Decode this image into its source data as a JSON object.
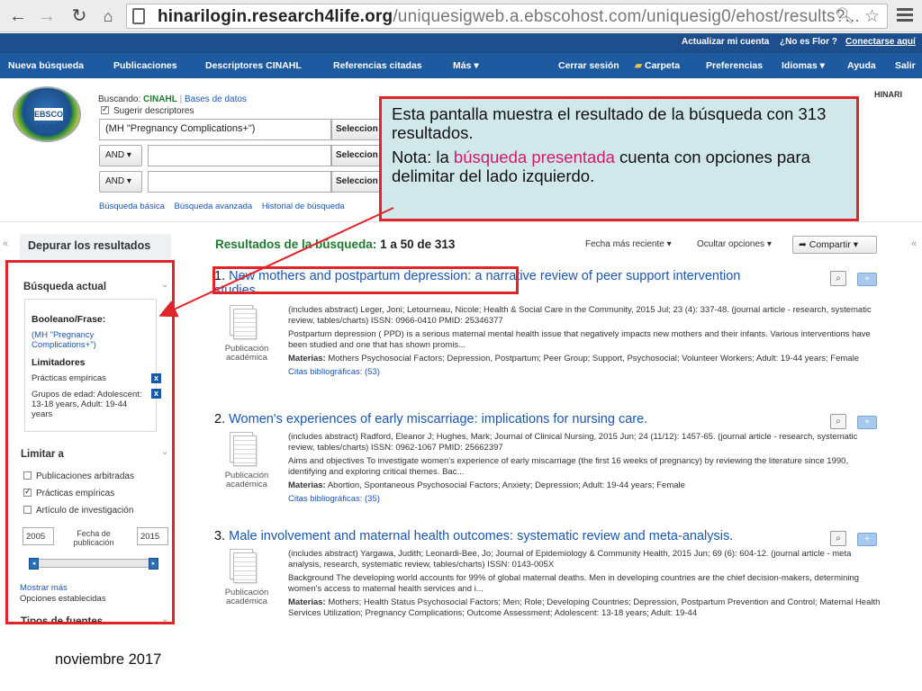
{
  "browser": {
    "url_host": "hinarilogin.research4life.org",
    "url_path": "/uniquesigweb.a.ebscohost.com/uniquesig0/ehost/results?..."
  },
  "topbar": {
    "update": "Actualizar mi cuenta",
    "not_user": "¿No es Flor ?",
    "logout": "Conectarse aquí"
  },
  "mainnav": {
    "left": [
      "Nueva búsqueda",
      "Publicaciones",
      "Descriptores CINAHL",
      "Referencias citadas",
      "Más"
    ],
    "right": [
      "Cerrar sesión",
      "Carpeta",
      "Preferencias",
      "Idiomas",
      "Ayuda",
      "Salir"
    ]
  },
  "search": {
    "logo_text": "EBSCO HOST",
    "searching_label": "Buscando:",
    "database": "CINAHL",
    "databases_link": "Bases de datos",
    "suggest": "Sugerir descriptores",
    "query": "(MH \"Pregnancy Complications+\")",
    "select_label": "Seleccion",
    "bool1": "AND",
    "bool2": "AND",
    "links": [
      "Búsqueda básica",
      "Búsqueda avanzada",
      "Historial de búsqueda"
    ],
    "hinari": "HINARI"
  },
  "callout": {
    "p1": "Esta pantalla muestra el resultado de la búsqueda con 313 resultados.",
    "p2_a": "Nota:  la ",
    "p2_pink": "búsqueda presentada",
    "p2_b": " cuenta con opciones para delimitar del lado izquierdo."
  },
  "sidebar": {
    "title": "Depurar los resultados",
    "current_search": "Búsqueda actual",
    "boolean_label": "Booleano/Frase:",
    "boolean_value": "(MH \"Pregnancy Complications+\")",
    "limiters_label": "Limitadores",
    "limiter1": "Prácticas empíricas",
    "limiter2": "Grupos de edad: Adolescent: 13-18 years, Adult: 19-44 years",
    "limit_to": "Limitar a",
    "limit_items": [
      "Publicaciones arbitradas",
      "Prácticas empíricas",
      "Artículo de investigación"
    ],
    "year_from": "2005",
    "year_to": "2015",
    "date_label": "Fecha de publicación",
    "show_more": "Mostrar más",
    "options_set": "Opciones establecidas",
    "source_types": "Tipos de fuentes"
  },
  "results": {
    "heading": "Resultados de la búsqueda:",
    "count": "1 a 50 de 313",
    "sort": "Fecha más reciente",
    "hide_options": "Ocultar opciones",
    "share": "Compartir",
    "items": [
      {
        "num": "1.",
        "title": "New mothers and postpartum depression: a narrative review of peer support intervention studies.",
        "citation": "(includes abstract) Leger, Joni; Letourneau, Nicole; Health & Social Care in the Community, 2015 Jul; 23 (4): 337-48. (journal article - research, systematic review, tables/charts) ISSN: 0966-0410 PMID: 25346377",
        "abstract": "Postpartum depression ( PPD) is a serious maternal mental health issue that negatively impacts new mothers and their infants. Various interventions have been studied and one that has shown promis...",
        "subjects_label": "Materias:",
        "subjects": " Mothers Psychosocial Factors; Depression, Postpartum; Peer Group; Support, Psychosocial; Volunteer Workers; Adult: 19-44 years; Female",
        "cited": "Citas bibliográficas: (53)",
        "type": "Publicación académica"
      },
      {
        "num": "2.",
        "title": "Women's experiences of early miscarriage: implications for nursing care.",
        "citation": "(includes abstract) Radford, Eleanor J; Hughes, Mark; Journal of Clinical Nursing, 2015 Jun; 24 (11/12): 1457-65. (journal article - research, systematic review, tables/charts) ISSN: 0962-1067 PMID: 25662397",
        "abstract": "Aims and objectives To investigate women's experience of early miscarriage (the first 16 weeks of pregnancy) by reviewing the literature since 1990, identifying and exploring critical themes. Bac...",
        "subjects_label": "Materias:",
        "subjects": " Abortion, Spontaneous Psychosocial Factors; Anxiety; Depression; Adult: 19-44 years; Female",
        "cited": "Citas bibliográficas: (35)",
        "type": "Publicación académica"
      },
      {
        "num": "3.",
        "title": "Male involvement and maternal health outcomes: systematic review and meta-analysis.",
        "citation": "(includes abstract) Yargawa, Judith; Leonardi-Bee, Jo; Journal of Epidemiology & Community Health, 2015 Jun; 69 (6): 604-12. (journal article - meta analysis, research, systematic review, tables/charts) ISSN: 0143-005X",
        "abstract": "Background The developing world accounts for 99% of global maternal deaths. Men in developing countries are the chief decision-makers, determining women's access to maternal health services and i...",
        "subjects_label": "Materias:",
        "subjects": " Mothers; Health Status Psychosocial Factors; Men; Role; Developing Countries; Depression, Postpartum Prevention and Control; Maternal Health Services Utilization; Pregnancy Complications; Outcome Assessment; Adolescent: 13-18 years; Adult: 19-44",
        "cited": "",
        "type": "Publicación académica"
      }
    ]
  },
  "footer": "noviembre 2017",
  "colors": {
    "accent_blue": "#1d5aa0",
    "link_blue": "#1a56b0",
    "green": "#1e7a2f",
    "red_box": "#e0242a",
    "callout_bg": "#d1e8ea"
  }
}
